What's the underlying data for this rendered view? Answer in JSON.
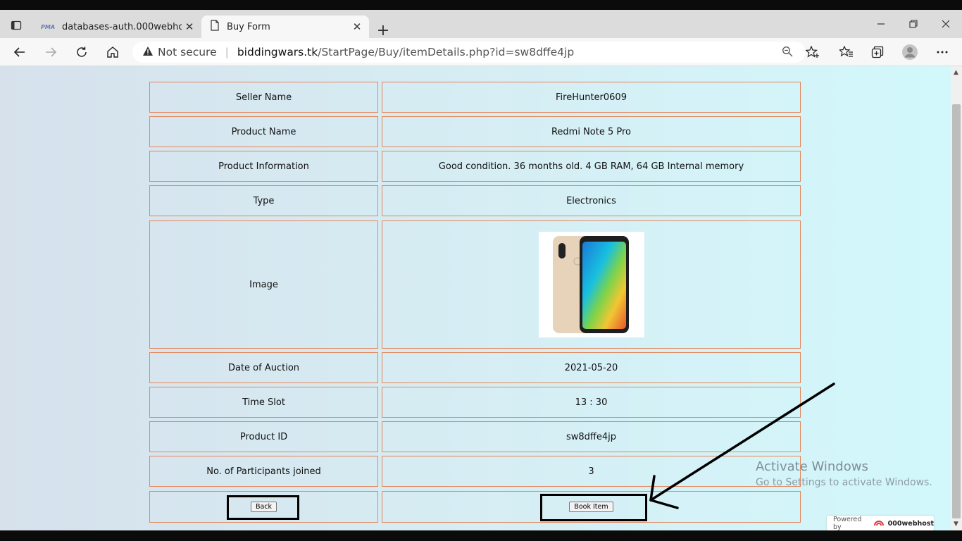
{
  "browser": {
    "tabs": [
      {
        "title": "databases-auth.000webhost.com",
        "active": false,
        "icon": "phpmyadmin-icon"
      },
      {
        "title": "Buy Form",
        "active": true,
        "icon": "page-icon"
      }
    ],
    "address": {
      "security_label": "Not secure",
      "host": "biddingwars.tk",
      "path": "/StartPage/Buy/itemDetails.php?id=sw8dffe4jp"
    }
  },
  "item_details": {
    "rows": [
      {
        "label": "Seller Name",
        "value": "FireHunter0609"
      },
      {
        "label": "Product Name",
        "value": "Redmi Note 5 Pro"
      },
      {
        "label": "Product Information",
        "value": "Good condition. 36 months old. 4 GB RAM, 64 GB Internal memory"
      },
      {
        "label": "Type",
        "value": "Electronics"
      },
      {
        "label": "Image",
        "value": ""
      },
      {
        "label": "Date of Auction",
        "value": "2021-05-20"
      },
      {
        "label": "Time Slot",
        "value": "13 : 30"
      },
      {
        "label": "Product ID",
        "value": "sw8dffe4jp"
      },
      {
        "label": "No. of Participants joined",
        "value": "3"
      }
    ],
    "back_label": "Back",
    "book_label": "Book Item"
  },
  "watermark": {
    "line1": "Activate Windows",
    "line2": "Go to Settings to activate Windows."
  },
  "badge": {
    "powered_by": "Powered by",
    "brand": "000webhost"
  },
  "colors": {
    "cell_border": "#e6865a",
    "annotation": "#000000"
  }
}
